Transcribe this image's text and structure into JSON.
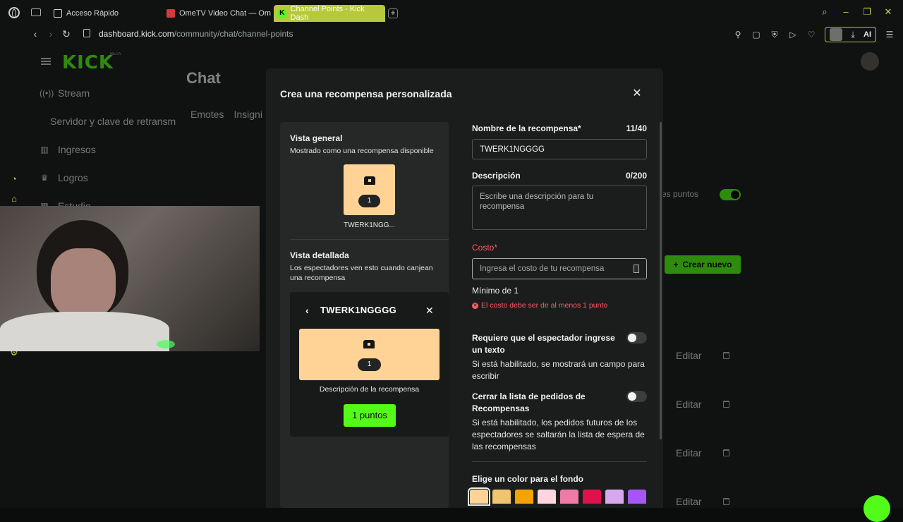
{
  "browser": {
    "tabs": [
      {
        "label": "Acceso Rápido"
      },
      {
        "label": "OmeTV Video Chat — Om"
      },
      {
        "label": "Channel Points - Kick Dash"
      }
    ],
    "url_host": "dashboard.kick.com",
    "url_path": "/community/chat/channel-points",
    "ai_label": "AI",
    "accent": "#b7c83a"
  },
  "sidebar": {
    "logo": "KICK",
    "beta": "BETA",
    "items": [
      {
        "label": "Stream",
        "icon": "broadcast-icon"
      },
      {
        "label": "Servidor y clave de retransm"
      },
      {
        "label": "Ingresos",
        "icon": "bar-chart-icon"
      },
      {
        "label": "Logros",
        "icon": "trophy-icon"
      },
      {
        "label": "Estudio",
        "icon": "studio-icon"
      }
    ]
  },
  "background_page": {
    "title": "Chat",
    "tabs": [
      "Emotes",
      "Insigni"
    ],
    "points_label": "es puntos",
    "create_button": "Crear nuevo",
    "edit_label": "Editar"
  },
  "modal": {
    "title": "Crea una recompensa personalizada",
    "preview": {
      "general_title": "Vista general",
      "general_sub": "Mostrado como una recompensa disponible",
      "mini_count": "1",
      "mini_name": "TWERK1NGG...",
      "detail_title": "Vista detallada",
      "detail_sub": "Los espectadores ven esto cuando canjean una recompensa",
      "detail_name": "TWERK1NGGGG",
      "detail_count": "1",
      "detail_desc": "Descripción de la recompensa",
      "points_button": "1 puntos",
      "card_color": "#ffd395"
    },
    "form": {
      "name_label": "Nombre de la recompensa*",
      "name_counter": "11/40",
      "name_value": "TWERK1NGGGG",
      "desc_label": "Descripción",
      "desc_counter": "0/200",
      "desc_placeholder": "Escribe una descripción para tu recompensa",
      "cost_label": "Costo*",
      "cost_placeholder": "Ingresa el costo de tu recompensa",
      "cost_min": "Mínimo de 1",
      "cost_error": "El costo debe ser de al menos 1 punto",
      "require_text_title": "Requiere que el espectador ingrese un texto",
      "require_text_sub": "Si está habilitado, se mostrará un campo para escribir",
      "skip_queue_title": "Cerrar la lista de pedidos de Recompensas",
      "skip_queue_sub": "Si está habilitado, los pedidos futuros de los espectadores se saltarán la lista de espera de las recompensas",
      "color_label": "Elige un color para el fondo",
      "swatches": [
        "#ffd395",
        "#f2c46d",
        "#f5a300",
        "#ffd6e0",
        "#f07aa6",
        "#e0104f",
        "#d7a8f0",
        "#a855f7"
      ]
    }
  }
}
